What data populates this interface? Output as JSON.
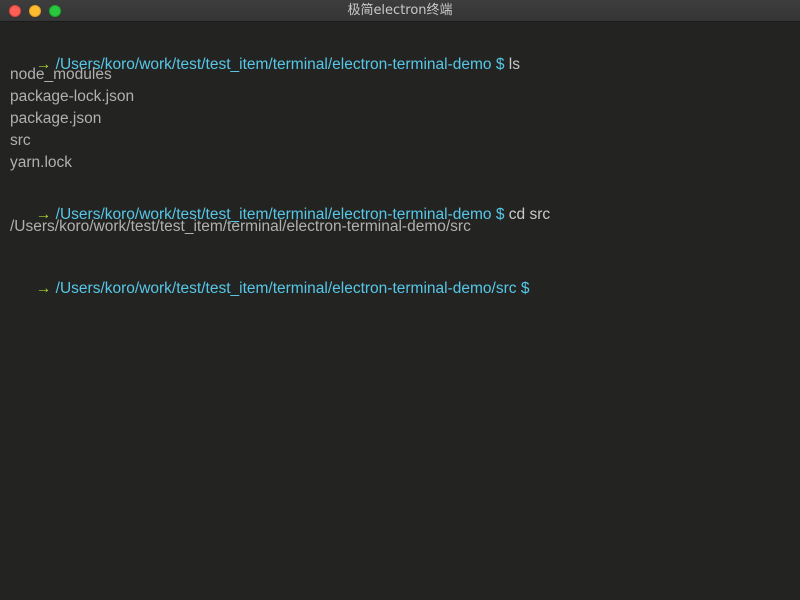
{
  "window": {
    "title": "极简electron终端"
  },
  "terminal": {
    "blocks": [
      {
        "prompt_arrow": "→",
        "path": "/Users/koro/work/test/test_item/terminal/electron-terminal-demo",
        "dollar": "$",
        "command": "ls"
      },
      {
        "prompt_arrow": "→",
        "path": "/Users/koro/work/test/test_item/terminal/electron-terminal-demo",
        "dollar": "$",
        "command": "cd src"
      },
      {
        "prompt_arrow": "→",
        "path": "/Users/koro/work/test/test_item/terminal/electron-terminal-demo/src",
        "dollar": "$",
        "command": ""
      }
    ],
    "ls_output": [
      "node_modules",
      "package-lock.json",
      "package.json",
      "src",
      "yarn.lock"
    ],
    "cd_output": "/Users/koro/work/test/test_item/terminal/electron-terminal-demo/src"
  },
  "colors": {
    "background": "#232421",
    "arrow": "#a8d13a",
    "path": "#56c7e8",
    "text": "#bcbcbc"
  }
}
